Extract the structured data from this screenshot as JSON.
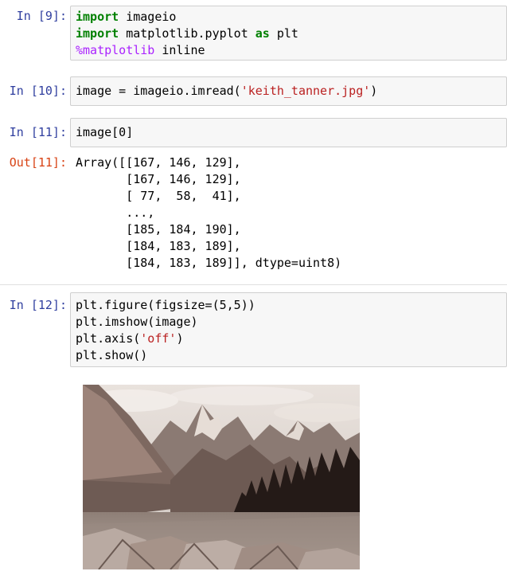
{
  "cells": [
    {
      "prompt": "In [9]:",
      "lines": [
        [
          {
            "t": "import",
            "c": "kw"
          },
          {
            "t": " imageio",
            "c": ""
          }
        ],
        [
          {
            "t": "import",
            "c": "kw"
          },
          {
            "t": " matplotlib.pyplot ",
            "c": ""
          },
          {
            "t": "as",
            "c": "kw"
          },
          {
            "t": " plt",
            "c": ""
          }
        ],
        [
          {
            "t": "%matplotlib",
            "c": "magic"
          },
          {
            "t": " inline",
            "c": ""
          }
        ]
      ]
    },
    {
      "prompt": "In [10]:",
      "lines": [
        [
          {
            "t": "image = imageio.imread(",
            "c": ""
          },
          {
            "t": "'keith_tanner.jpg'",
            "c": "str"
          },
          {
            "t": ")",
            "c": ""
          }
        ]
      ]
    },
    {
      "prompt": "In [11]:",
      "lines": [
        [
          {
            "t": "image[0]",
            "c": ""
          }
        ]
      ],
      "output_prompt": "Out[11]:",
      "output_lines": [
        "Array([[167, 146, 129],",
        "       [167, 146, 129],",
        "       [ 77,  58,  41],",
        "       ...,",
        "       [185, 184, 190],",
        "       [184, 183, 189],",
        "       [184, 183, 189]], dtype=uint8)"
      ]
    },
    {
      "prompt": "In [12]:",
      "lines": [
        [
          {
            "t": "plt.figure(figsize=(5,5))",
            "c": ""
          }
        ],
        [
          {
            "t": "plt.imshow(image)",
            "c": ""
          }
        ],
        [
          {
            "t": "plt.axis(",
            "c": ""
          },
          {
            "t": "'off'",
            "c": "str"
          },
          {
            "t": ")",
            "c": ""
          }
        ],
        [
          {
            "t": "plt.show()",
            "c": ""
          }
        ]
      ]
    }
  ],
  "figure": {
    "icon": "mountain-lake-image"
  },
  "colors": {
    "prompt_in": "#303f9f",
    "prompt_out": "#d84315",
    "keyword": "#008000",
    "string": "#ba2121",
    "magic": "#aa22ff",
    "cell_bg": "#f7f7f7",
    "cell_border": "#cfcfcf"
  }
}
